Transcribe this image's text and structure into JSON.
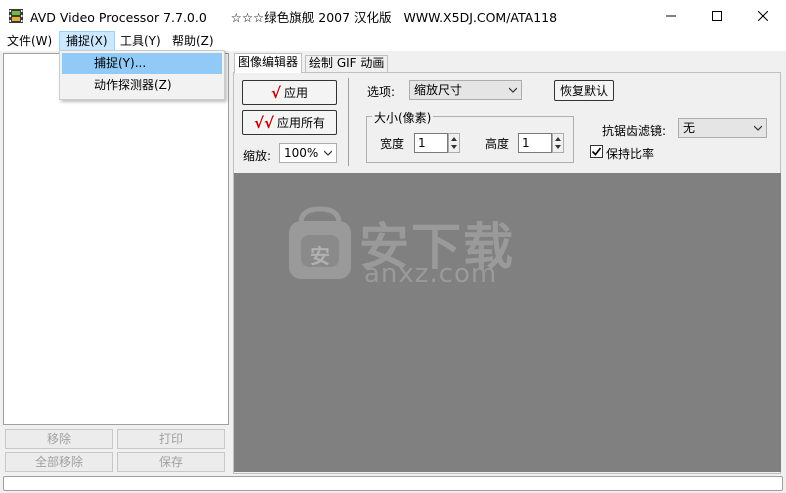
{
  "window": {
    "title": "AVD Video Processor 7.7.0.0      ☆☆☆绿色旗舰 2007 汉化版   WWW.X5DJ.COM/ATA118",
    "minimize_icon": "minimize-icon",
    "maximize_icon": "maximize-icon",
    "close_icon": "close-icon"
  },
  "menu": {
    "file": "文件(W)",
    "capture": "捕捉(X)",
    "tools": "工具(Y)",
    "help": "帮助(Z)"
  },
  "capture_menu": {
    "capture": "捕捉(Y)...",
    "motion_detector": "动作探测器(Z)"
  },
  "left_panel": {
    "remove": "移除",
    "print": "打印",
    "remove_all": "全部移除",
    "save": "保存"
  },
  "tabs": {
    "image_editor": "图像编辑器",
    "draw_gif": "绘制 GIF 动画"
  },
  "editor": {
    "apply": "应用",
    "apply_all": "应用所有",
    "zoom_label": "缩放:",
    "zoom_value": "100%",
    "option_label": "选项:",
    "option_value": "缩放尺寸",
    "restore_default": "恢复默认",
    "size_group": "大小(像素)",
    "width_label": "宽度",
    "width_value": "1",
    "height_label": "高度",
    "height_value": "1",
    "antialias_label": "抗锯齿滤镜:",
    "antialias_value": "无",
    "keep_ratio": "保持比率",
    "keep_ratio_checked": true
  },
  "watermark": {
    "text_cn": "安下载",
    "text_en": "anxz.com",
    "badge": "安"
  },
  "colors": {
    "preview_bg": "#808080",
    "menu_highlight": "#cce8ff",
    "dropdown_highlight": "#91c9f7",
    "check_red": "#c00000"
  }
}
